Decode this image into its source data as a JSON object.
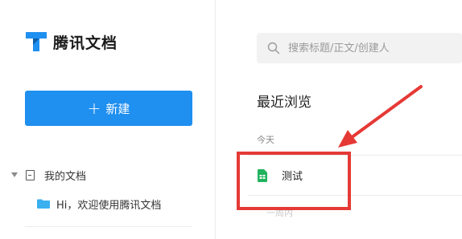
{
  "app": {
    "brand": "腾讯文档"
  },
  "sidebar": {
    "new_button_label": "新建",
    "my_docs_label": "我的文档",
    "welcome_doc_label": "Hi，欢迎使用腾讯文档"
  },
  "search": {
    "placeholder": "搜索标题/正文/创建人"
  },
  "recent": {
    "title": "最近浏览",
    "group_today": "今天",
    "files": [
      {
        "name": "测试",
        "type": "sheet"
      }
    ],
    "group_next": "一周内"
  },
  "colors": {
    "accent": "#1f8ff0",
    "sheet_green": "#22b35e",
    "annotation_red": "#e53935",
    "folder_blue": "#3ab0f0"
  },
  "icons": {
    "logo": "tencent-docs-logo",
    "search": "search-icon",
    "caret": "caret-down-icon",
    "doc": "document-icon",
    "folder": "folder-icon",
    "sheet": "spreadsheet-icon"
  }
}
